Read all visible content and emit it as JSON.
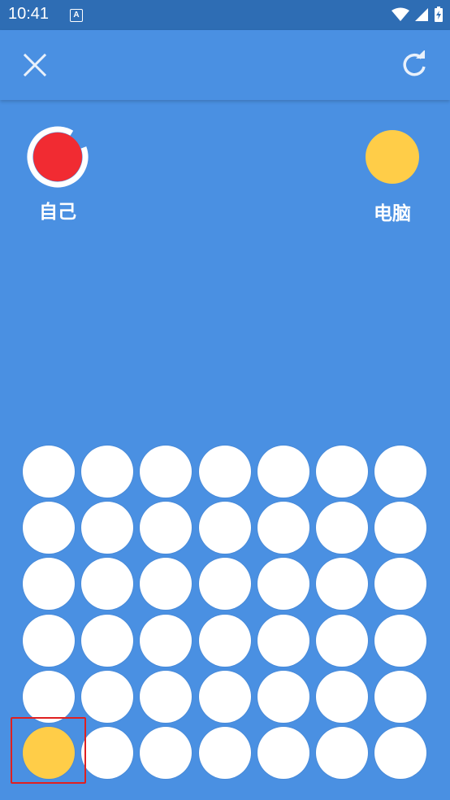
{
  "status": {
    "time": "10:41",
    "notification_glyph": "A"
  },
  "toolbar": {
    "close_icon": "close-icon",
    "refresh_icon": "refresh-icon"
  },
  "players": [
    {
      "label": "自己",
      "color": "#F12B32",
      "active": true
    },
    {
      "label": "电脑",
      "color": "#FFCD48",
      "active": false
    }
  ],
  "board": {
    "columns": 7,
    "rows": 6,
    "pieces": [
      {
        "row": 6,
        "column": 1,
        "color": "yellow"
      }
    ],
    "highlighted_cell": {
      "row": 6,
      "column": 1
    }
  },
  "colors": {
    "background": "#4A90E2",
    "status_bar": "#2E6DB4",
    "empty_cell": "#FFFFFF",
    "red_piece": "#F12B32",
    "yellow_piece": "#FFCD48",
    "highlight": "#E02020"
  }
}
